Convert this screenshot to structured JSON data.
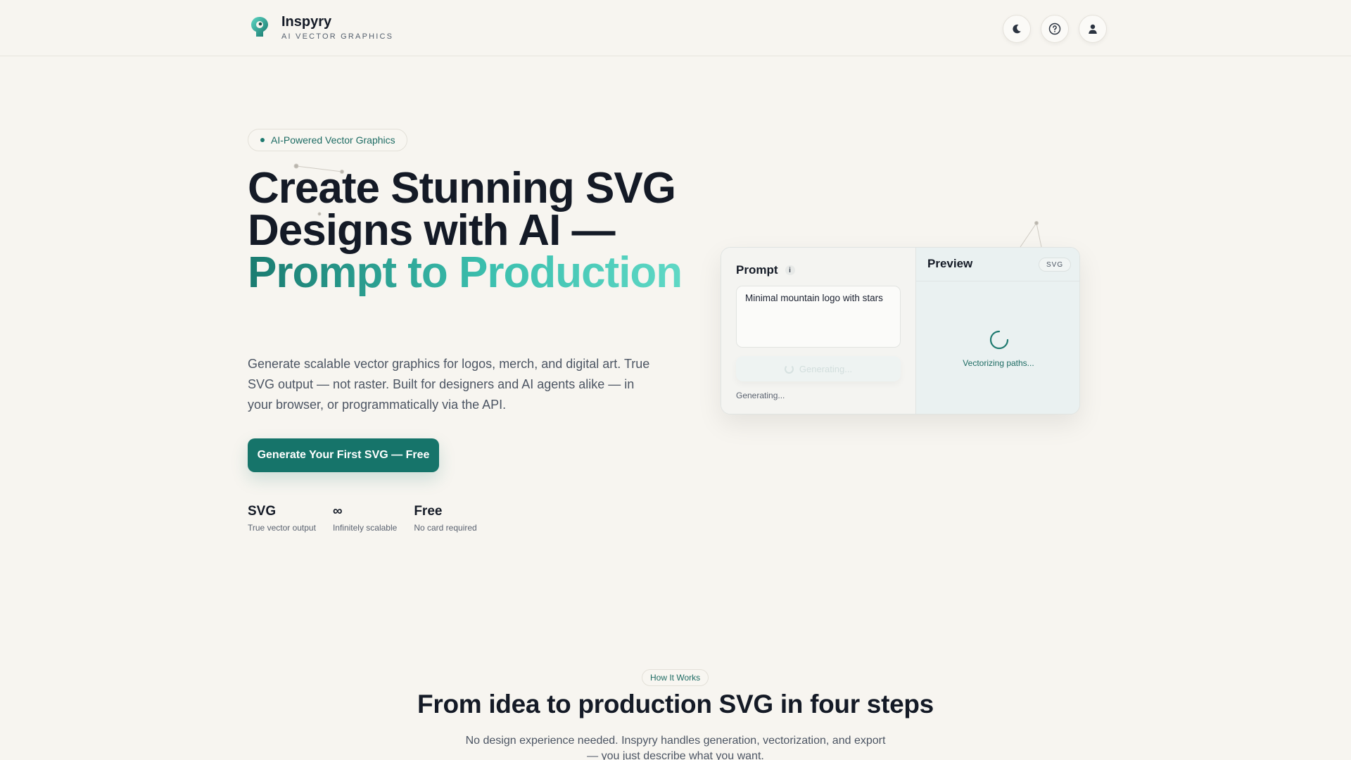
{
  "header": {
    "brand_name": "Inspyry",
    "brand_tagline": "AI VECTOR GRAPHICS",
    "buttons": [
      "theme-toggle",
      "help",
      "account"
    ]
  },
  "hero": {
    "badge": "AI-Powered Vector Graphics",
    "title_plain": "Create Stunning SVG Designs with AI — ",
    "title_accent": "Prompt to Production",
    "subtitle": "Generate scalable vector graphics for logos, merch, and digital art. True SVG output — not raster. Built for designers and AI agents alike — in your browser, or programmatically via the API.",
    "cta_label": "Generate Your First SVG — Free",
    "stats": [
      {
        "value": "SVG",
        "label": "True vector output"
      },
      {
        "value": "∞",
        "label": "Infinitely scalable"
      },
      {
        "value": "Free",
        "label": "No card required"
      }
    ]
  },
  "demo": {
    "prompt_label": "Prompt",
    "info_glyph": "i",
    "prompt_value": "Minimal mountain logo with stars",
    "generate_button": "Generating...",
    "status": "Generating...",
    "preview_label": "Preview",
    "format_badge": "SVG",
    "preview_status": "Vectorizing paths..."
  },
  "how_it_works": {
    "badge": "How It Works",
    "title": "From idea to production SVG in four steps",
    "subtitle": "No design experience needed. Inspyry handles generation, vectorization, and export — you just describe what you want."
  },
  "colors": {
    "background": "#f7f5f0",
    "brand": "#16746a",
    "accent_gradient_end": "#5fd8c5",
    "text": "#141a26"
  }
}
